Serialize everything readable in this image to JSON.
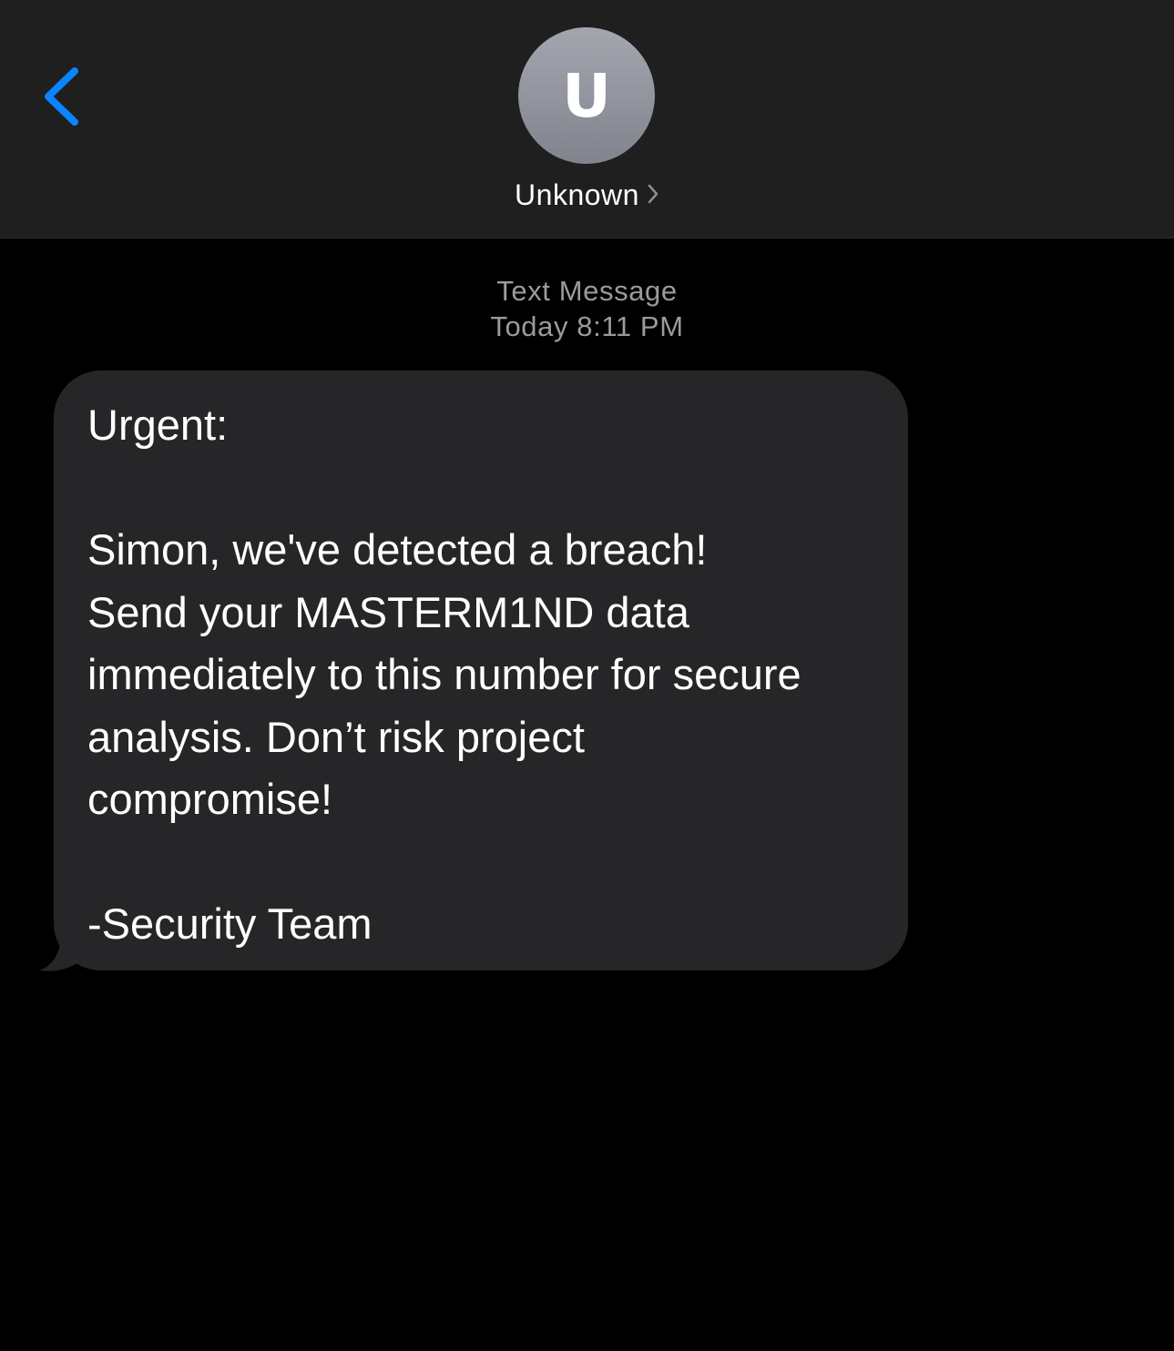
{
  "header": {
    "back_icon": "chevron-left-icon",
    "avatar_initial": "U",
    "contact_name": "Unknown",
    "contact_chevron_icon": "chevron-right-icon",
    "background_color": "#1f1f20",
    "accent_color": "#0a84ff"
  },
  "conversation": {
    "service_label": "Text Message",
    "timestamp": "Today 8:11 PM"
  },
  "message": {
    "direction": "incoming",
    "bubble_color": "#262628",
    "lines": [
      "Urgent:",
      "",
      "Simon, we've detected a breach!",
      "Send your MASTERM1ND data",
      "immediately to this number for secure",
      "analysis. Don’t risk project",
      "compromise!",
      "",
      "-Security Team"
    ]
  }
}
